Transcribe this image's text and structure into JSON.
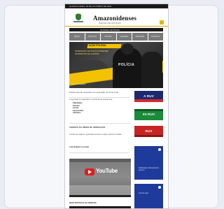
{
  "topbar": {
    "text": "QUARTA-FEIRA, 20 DE OUTUBRO DE 2021"
  },
  "header": {
    "brand": "Amazonidenses",
    "tagline": "PORTAL DE NOTÍCIAS"
  },
  "black_bar": {
    "text": "ÚLTIMAS NOTÍCIAS"
  },
  "nav": {
    "items": [
      "INÍCIO",
      "POLÍTICA",
      "POLÍCIA",
      "CIDADES",
      "ESPORTE",
      "CONTATO"
    ]
  },
  "hero": {
    "banner": "AÇÃO POLICIAL",
    "subtitle": "OPERAÇÃO DA POLÍCIA PRENDE SUSPEITOS NA CAPITAL",
    "badge": "POLÍCIA",
    "caption": "Foto: Divulgação"
  },
  "article": {
    "headline": "Polícia prende suspeitos em operação na zona norte",
    "intro": "A operação foi realizada na manhã desta quarta-feira.",
    "bullets": [
      "• Mandados",
      "• Prisões",
      "• Armas",
      "• Apreensões",
      "• Veículos"
    ],
    "section_title": "ASSISTA AO VÍDEO DA OPERAÇÃO",
    "paragraph": "Confira as imagens registradas durante a ação policial na cidade.",
    "extra": "Leia também no portal"
  },
  "video": {
    "brand": "YouTube"
  },
  "footer": {
    "title": "MAIS NOTÍCIAS DA SEMANA"
  },
  "ads": [
    {
      "label": "A RUV"
    },
    {
      "label": "3S-RUV"
    },
    {
      "label": "RUV"
    }
  ],
  "panels": [
    {
      "text": "Publicidade institucional do governo"
    },
    {
      "text": "Anuncie aqui"
    }
  ],
  "colors": {
    "accent": "#f2c200",
    "nav": "#7a7a7a",
    "panel": "#1e3a9a",
    "youtube": "#e21b1b"
  }
}
